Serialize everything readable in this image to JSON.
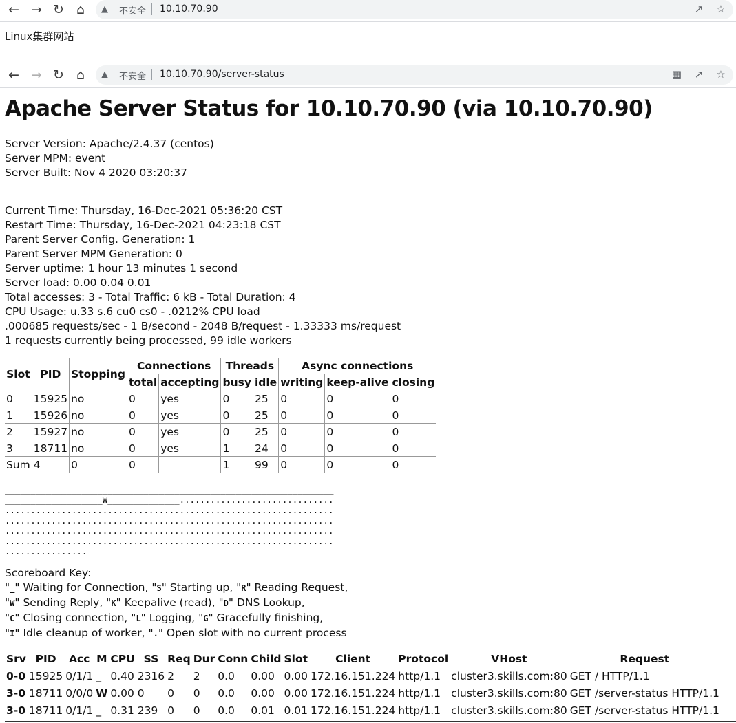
{
  "browser1": {
    "insecure_label": "不安全",
    "url": "10.10.70.90"
  },
  "site_text": "Linux集群网站",
  "browser2": {
    "insecure_label": "不安全",
    "url": "10.10.70.90/server-status"
  },
  "status": {
    "title": "Apache Server Status for 10.10.70.90 (via 10.10.70.90)",
    "server_version": "Server Version: Apache/2.4.37 (centos)",
    "server_mpm": "Server MPM: event",
    "server_built": "Server Built: Nov 4 2020 03:20:37",
    "current_time": "Current Time: Thursday, 16-Dec-2021 05:36:20 CST",
    "restart_time": "Restart Time: Thursday, 16-Dec-2021 04:23:18 CST",
    "config_generation": "Parent Server Config. Generation: 1",
    "mpm_generation": "Parent Server MPM Generation: 0",
    "uptime": "Server uptime: 1 hour 13 minutes 1 second",
    "load": "Server load: 0.00 0.04 0.01",
    "accesses": "Total accesses: 3 - Total Traffic: 6 kB - Total Duration: 4",
    "cpu": "CPU Usage: u.33 s.6 cu0 cs0 - .0212% CPU load",
    "rates": ".000685 requests/sec - 1 B/second - 2048 B/request - 1.33333 ms/request",
    "processing": "1 requests currently being processed, 99 idle workers"
  },
  "workers_table": {
    "group_headers": [
      "Slot",
      "PID",
      "Stopping",
      "Connections",
      "Threads",
      "Async connections"
    ],
    "sub_headers": [
      "total",
      "accepting",
      "busy",
      "idle",
      "writing",
      "keep-alive",
      "closing"
    ],
    "rows": [
      [
        "0",
        "15925",
        "no",
        "0",
        "yes",
        "0",
        "25",
        "0",
        "0",
        "0"
      ],
      [
        "1",
        "15926",
        "no",
        "0",
        "yes",
        "0",
        "25",
        "0",
        "0",
        "0"
      ],
      [
        "2",
        "15927",
        "no",
        "0",
        "yes",
        "0",
        "25",
        "0",
        "0",
        "0"
      ],
      [
        "3",
        "18711",
        "no",
        "0",
        "yes",
        "1",
        "24",
        "0",
        "0",
        "0"
      ],
      [
        "Sum",
        "4",
        "0",
        "0",
        "",
        "1",
        "99",
        "0",
        "0",
        "0"
      ]
    ]
  },
  "scoreboard": [
    "________________________________________________________________",
    "___________________W______________..............................",
    "................................................................",
    "................................................................",
    "................................................................",
    "................................................................",
    "................"
  ],
  "scoreboard_key": {
    "title": "Scoreboard Key:",
    "lines": [
      [
        [
          "_",
          " Waiting for Connection, "
        ],
        [
          "S",
          " Starting up, "
        ],
        [
          "R",
          " Reading Request,"
        ]
      ],
      [
        [
          "W",
          " Sending Reply, "
        ],
        [
          "K",
          " Keepalive (read), "
        ],
        [
          "D",
          " DNS Lookup,"
        ]
      ],
      [
        [
          "C",
          " Closing connection, "
        ],
        [
          "L",
          " Logging, "
        ],
        [
          "G",
          " Gracefully finishing,"
        ]
      ],
      [
        [
          "I",
          " Idle cleanup of worker, "
        ],
        [
          ".",
          " Open slot with no current process"
        ]
      ]
    ]
  },
  "requests_table": {
    "headers": [
      "Srv",
      "PID",
      "Acc",
      "M",
      "CPU",
      "SS",
      "Req",
      "Dur",
      "Conn",
      "Child",
      "Slot",
      "Client",
      "Protocol",
      "VHost",
      "Request"
    ],
    "rows": [
      [
        "0-0",
        "15925",
        "0/1/1",
        "_",
        "0.40",
        "2316",
        "2",
        "2",
        "0.0",
        "0.00",
        "0.00",
        "172.16.151.224",
        "http/1.1",
        "cluster3.skills.com:80",
        "GET / HTTP/1.1"
      ],
      [
        "3-0",
        "18711",
        "0/0/0",
        "W",
        "0.00",
        "0",
        "0",
        "0",
        "0.0",
        "0.00",
        "0.00",
        "172.16.151.224",
        "http/1.1",
        "cluster3.skills.com:80",
        "GET /server-status HTTP/1.1"
      ],
      [
        "3-0",
        "18711",
        "0/1/1",
        "_",
        "0.31",
        "239",
        "0",
        "0",
        "0.0",
        "0.01",
        "0.01",
        "172.16.151.224",
        "http/1.1",
        "cluster3.skills.com:80",
        "GET /server-status HTTP/1.1"
      ]
    ]
  }
}
